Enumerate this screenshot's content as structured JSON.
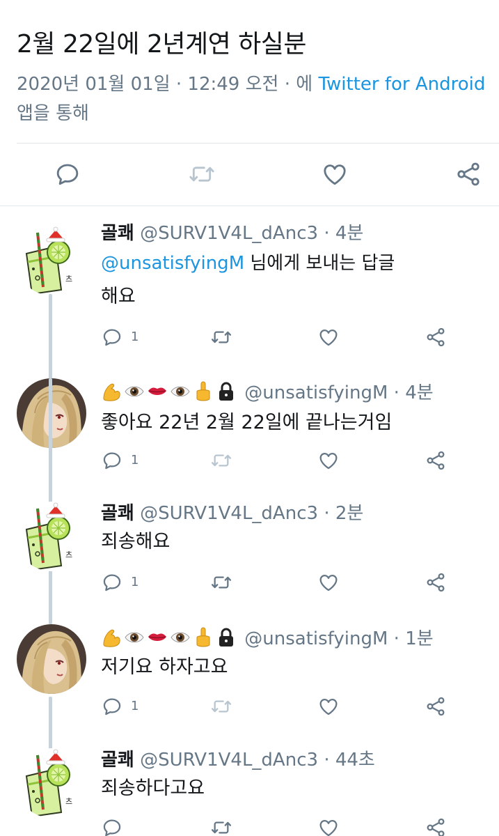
{
  "tweet": {
    "text": "2월 22일에 2년계연 하실분",
    "meta_prefix": "2020년 01월 01일 · 12:49 오전 · 에 ",
    "meta_source": "Twitter for Android",
    "meta_suffix": "앱을 통해"
  },
  "icons": {
    "reply": "reply-bubble-icon",
    "retweet": "retweet-icon",
    "like": "heart-icon",
    "share": "share-icon",
    "lock": "lock-icon"
  },
  "colors": {
    "link": "#1b95e0",
    "muted": "#657786",
    "retweet_disabled": "#b8c5cf"
  },
  "emojis": [
    "flexed-biceps",
    "eye",
    "lips",
    "eye",
    "middle-finger",
    "lock"
  ],
  "replies": [
    {
      "name": "골쾌",
      "handle": "@SURV1V4L_dAnc3",
      "time": "4분",
      "replying_mention": "@unsatisfyingM",
      "replying_suffix": " 님에게 보내는 답글",
      "text": "해요",
      "reply_count": "1",
      "retweet_enabled": true,
      "avatar": "lime-drink-avatar"
    },
    {
      "name": "",
      "handle": "@unsatisfyingM",
      "time": "4분",
      "text": "좋아요 22년 2월 22일에 끝나는거임",
      "reply_count": "1",
      "retweet_enabled": false,
      "avatar": "blonde-portrait-avatar"
    },
    {
      "name": "골쾌",
      "handle": "@SURV1V4L_dAnc3",
      "time": "2분",
      "text": "죄송해요",
      "reply_count": "1",
      "retweet_enabled": true,
      "avatar": "lime-drink-avatar"
    },
    {
      "name": "",
      "handle": "@unsatisfyingM",
      "time": "1분",
      "text": "저기요 하자고요",
      "reply_count": "1",
      "retweet_enabled": false,
      "avatar": "blonde-portrait-avatar"
    },
    {
      "name": "골쾌",
      "handle": "@SURV1V4L_dAnc3",
      "time": "44초",
      "text": "죄송하다고요",
      "reply_count": "",
      "retweet_enabled": true,
      "avatar": "lime-drink-avatar"
    }
  ]
}
